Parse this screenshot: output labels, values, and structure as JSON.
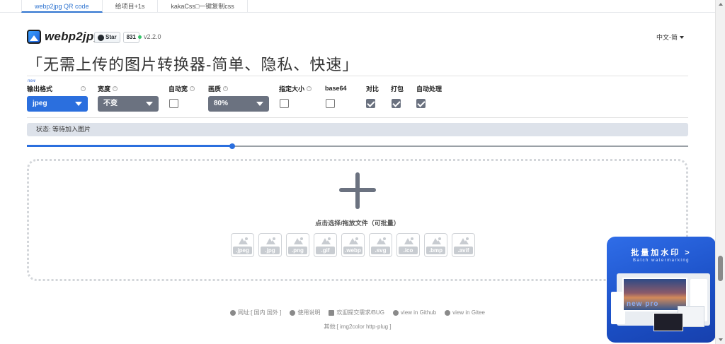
{
  "top_tabs": [
    "webp2jpg QR code",
    "给项目+1s",
    "kakaCss□一键复制css"
  ],
  "header": {
    "logo_text": "webp2jpg",
    "github_star_label": "Star",
    "github_star_count": "831",
    "version": "v2.2.0",
    "language": "中文-简"
  },
  "slogan": "「无需上传的图片转换器-简单、隐私、快速」",
  "options": {
    "new_badge": "new",
    "output_format_label": "输出格式",
    "output_format_value": "jpeg",
    "width_label": "宽度",
    "width_value": "不变",
    "auto_width_label": "自动宽",
    "quality_label": "画质",
    "quality_value": "80%",
    "fixed_size_label": "指定大小",
    "base64_label": "base64",
    "compare_label": "对比",
    "pack_label": "打包",
    "auto_process_label": "自动处理",
    "auto_width_checked": false,
    "fixed_size_checked": false,
    "base64_checked": false,
    "compare_checked": true,
    "pack_checked": true,
    "auto_process_checked": true
  },
  "status_text": "状态: 等待加入图片",
  "progress_fraction": 0.31,
  "dropzone": {
    "hint": "点击选择/拖放文件（可批量）",
    "formats": [
      ".jpeg",
      ".jpg",
      ".png",
      ".gif",
      ".webp",
      ".svg",
      ".ico",
      ".bmp",
      ".avif"
    ]
  },
  "footer": {
    "links": [
      "网址:[ 国内 国外 ]",
      "使用说明",
      "欢迎提交需求/BUG",
      "view in Github",
      "view in Gitee"
    ],
    "others": "其他:[  img2color   http-plug  ]"
  },
  "promo": {
    "title": "批量加水印 >",
    "subtitle": "Batch watermarking",
    "watermark_text": "new pro"
  },
  "colors": {
    "accent": "#2f74d0",
    "select_blue": "#2b6fde",
    "select_gray": "#6b7280",
    "promo_blue": "#2f6de8"
  }
}
